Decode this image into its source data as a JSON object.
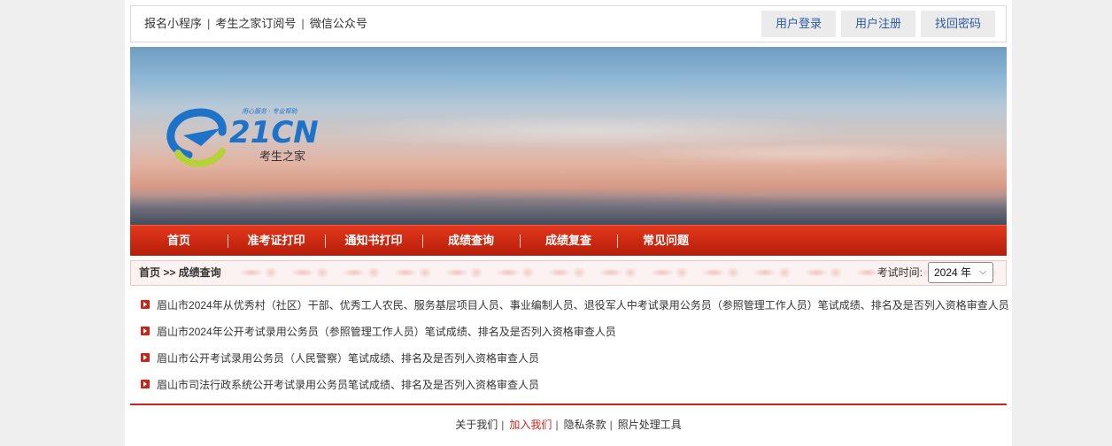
{
  "topbar": {
    "links": [
      "报名小程序",
      "考生之家订阅号",
      "微信公众号"
    ],
    "separator": "|",
    "buttons": [
      "用户登录",
      "用户注册",
      "找回密码"
    ]
  },
  "banner": {
    "logo": {
      "slogan": "用心服务 · 专业帮助",
      "brand": "21CN",
      "name": "考生之家",
      "colors": {
        "blue": "#1e73c8",
        "green": "#b6d23a"
      }
    }
  },
  "nav": {
    "items": [
      "首页",
      "准考证打印",
      "通知书打印",
      "成绩查询",
      "成绩复查",
      "常见问题"
    ],
    "color": "#cc2a12"
  },
  "breadcrumb": {
    "text": "首页 >> 成绩查询",
    "year_label": "考试时间:",
    "year_value": "2024 年"
  },
  "list": {
    "items": [
      "眉山市2024年从优秀村（社区）干部、优秀工人农民、服务基层项目人员、事业编制人员、退役军人中考试录用公务员（参照管理工作人员）笔试成绩、排名及是否列入资格审查人员",
      "眉山市2024年公开考试录用公务员（参照管理工作人员）笔试成绩、排名及是否列入资格审查人员",
      "眉山市公开考试录用公务员（人民警察）笔试成绩、排名及是否列入资格审查人员",
      "眉山市司法行政系统公开考试录用公务员笔试成绩、排名及是否列入资格审查人员"
    ],
    "bullet_color": "#c8241a"
  },
  "footer": {
    "links": [
      "关于我们",
      "加入我们",
      "隐私条款",
      "照片处理工具"
    ],
    "separator": "|",
    "highlight_color": "#d6221a"
  }
}
